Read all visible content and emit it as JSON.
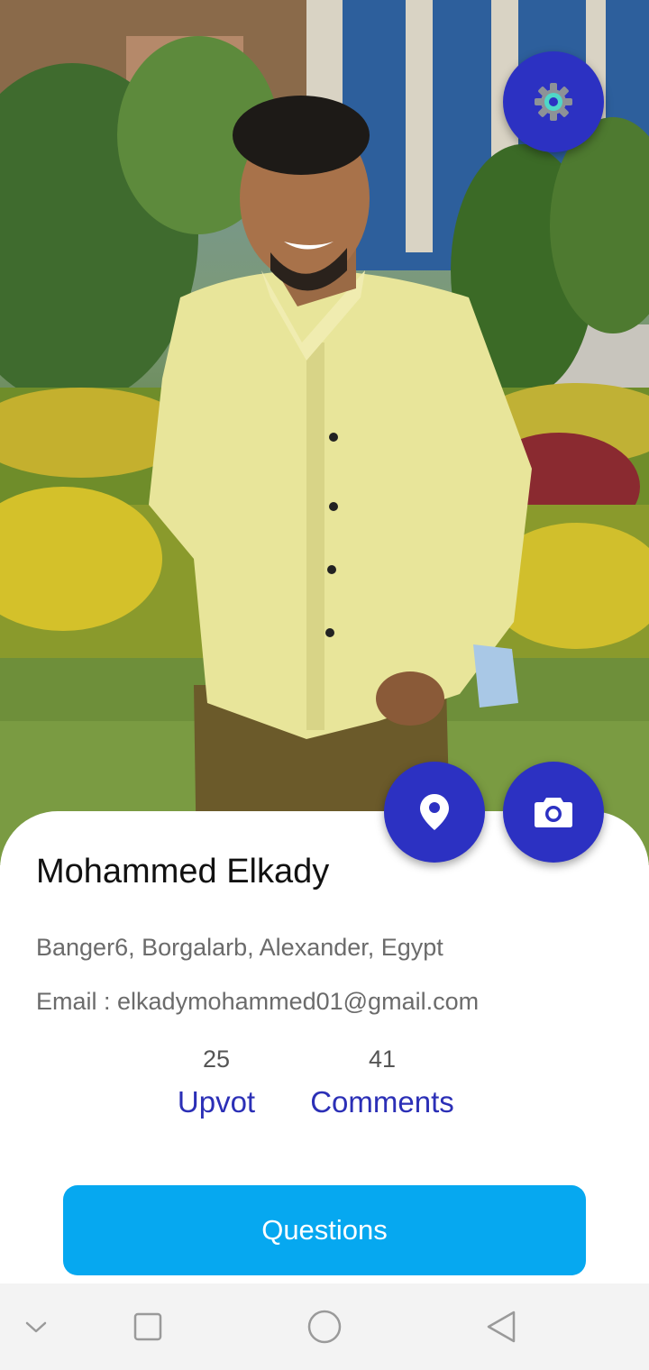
{
  "profile": {
    "name": "Mohammed Elkady",
    "address": "Banger6, Borgalarb, Alexander, Egypt",
    "email": "Email : elkadymohammed01@gmail.com"
  },
  "stats": {
    "upvote_count": "25",
    "upvote_label": "Upvot",
    "comments_count": "41",
    "comments_label": "Comments"
  },
  "actions": {
    "questions_label": "Questions"
  },
  "icons": {
    "settings": "gear-icon",
    "location": "location-pin-icon",
    "camera": "camera-icon",
    "nav_down": "chevron-down-icon",
    "nav_recent": "square-icon",
    "nav_home": "circle-icon",
    "nav_back": "triangle-back-icon"
  },
  "colors": {
    "fab": "#2c31c2",
    "primary_button": "#06a8f0",
    "stat_label": "#2b2fb6"
  }
}
